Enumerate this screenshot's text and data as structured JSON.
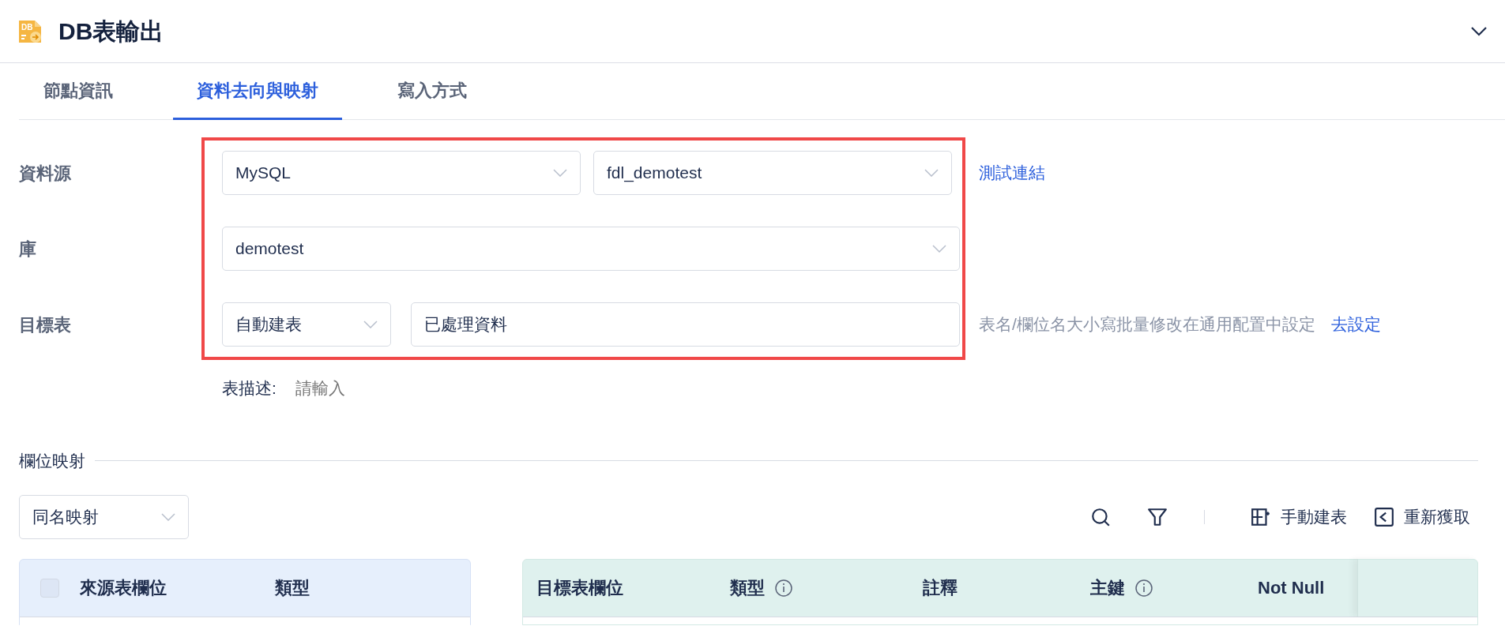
{
  "header": {
    "title": "DB表輸出",
    "icon_text": "DB"
  },
  "tabs": [
    {
      "label": "節點資訊",
      "selected": false
    },
    {
      "label": "資料去向與映射",
      "selected": true
    },
    {
      "label": "寫入方式",
      "selected": false
    }
  ],
  "data_source": {
    "label": "資料源",
    "type": "MySQL",
    "connection": "fdl_demotest",
    "link": "測試連結"
  },
  "database": {
    "label": "庫",
    "value": "demotest"
  },
  "target_table": {
    "label": "目標表",
    "mode": "自動建表",
    "name": "已處理資料",
    "hint": "表名/欄位名大小寫批量修改在通用配置中設定",
    "link": "去設定"
  },
  "table_description": {
    "label": "表描述:",
    "placeholder": "請輸入"
  },
  "field_mapping": {
    "title": "欄位映射",
    "mode": "同名映射",
    "toolbar": [
      {
        "kind": "search"
      },
      {
        "kind": "filter"
      },
      {
        "kind": "separator"
      },
      {
        "kind": "create_table",
        "label": "手動建表"
      },
      {
        "kind": "refetch",
        "label": "重新獲取"
      }
    ]
  },
  "source_grid": {
    "select_all_checked": false,
    "columns": [
      {
        "label": "來源表欄位"
      },
      {
        "label": "類型"
      }
    ]
  },
  "target_grid": {
    "columns": [
      {
        "label": "目標表欄位",
        "info": false
      },
      {
        "label": "類型",
        "info": true
      },
      {
        "label": "註釋",
        "info": false
      },
      {
        "label": "主鍵",
        "info": true
      },
      {
        "label": "Not Null",
        "info": false
      }
    ]
  }
}
